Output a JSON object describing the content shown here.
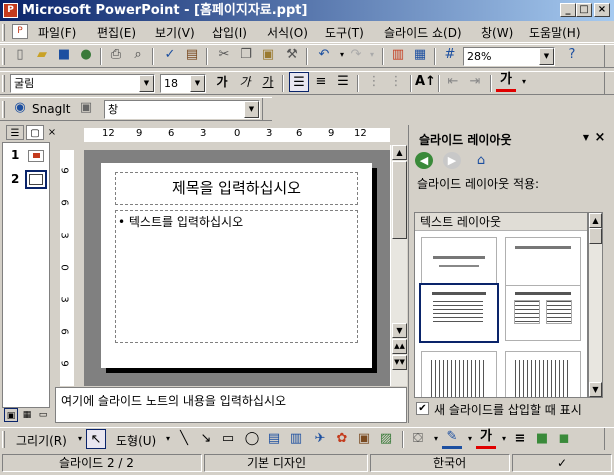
{
  "window": {
    "title": "Microsoft PowerPoint - [홈페이지자료.ppt]",
    "min": "_",
    "max": "□",
    "close": "×"
  },
  "menu": [
    "파일(F)",
    "편집(E)",
    "보기(V)",
    "삽입(I)",
    "서식(O)",
    "도구(T)",
    "슬라이드 쇼(D)",
    "창(W)",
    "도움말(H)"
  ],
  "toolbar": {
    "zoom": "28%"
  },
  "format": {
    "font": "굴림",
    "size": "18",
    "bold": "가",
    "italic": "가",
    "underline": "가",
    "fontcolor": "가"
  },
  "snagit": {
    "label": "SnagIt",
    "window": "창"
  },
  "slides": {
    "items": [
      "1",
      "2"
    ]
  },
  "ruler": {
    "h": [
      "12",
      "9",
      "6",
      "3",
      "0",
      "3",
      "6",
      "9",
      "12"
    ],
    "v": [
      "9",
      "6",
      "3",
      "0",
      "3",
      "6",
      "9"
    ]
  },
  "slide": {
    "title": "제목을 입력하십시오",
    "body": "• 텍스트를 입력하십시오"
  },
  "notes": {
    "text": "여기에 슬라이드 노트의 내용을 입력하십시오"
  },
  "taskpane": {
    "title": "슬라이드 레이아웃",
    "apply_label": "슬라이드 레이아웃 적용:",
    "group": "텍스트 레이아웃",
    "checkbox_label": "새 슬라이드를 삽입할 때 표시",
    "checked": true
  },
  "drawing": {
    "draw": "그리기(R)",
    "autoshapes": "도형(U)",
    "fontcolor": "가"
  },
  "status": {
    "slide": "슬라이드 2 / 2",
    "design": "기본 디자인",
    "lang": "한국어"
  }
}
